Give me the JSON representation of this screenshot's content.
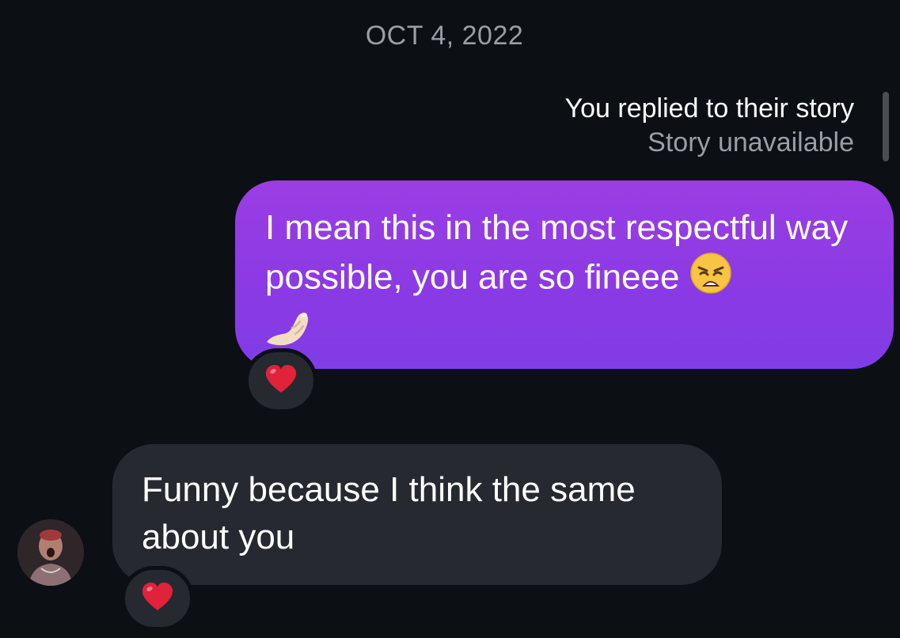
{
  "conversation": {
    "date_divider": "OCT 4, 2022",
    "story_reply": {
      "label": "You replied to their story",
      "status": "Story unavailable"
    },
    "messages": [
      {
        "direction": "outgoing",
        "text": "I mean this in the most respectful way possible, you are so fineee",
        "emojis": [
          "weary-face-emoji",
          "pinched-fingers-emoji"
        ],
        "reaction": "heart-emoji"
      },
      {
        "direction": "incoming",
        "text": "Funny because I think the same about you",
        "reaction": "heart-emoji"
      }
    ]
  },
  "colors": {
    "background": "#0c0f14",
    "outgoing_bubble": "#8a3ae4",
    "incoming_bubble": "#26292f",
    "secondary_text": "#9a9ea5",
    "heart": "#e0223a"
  }
}
